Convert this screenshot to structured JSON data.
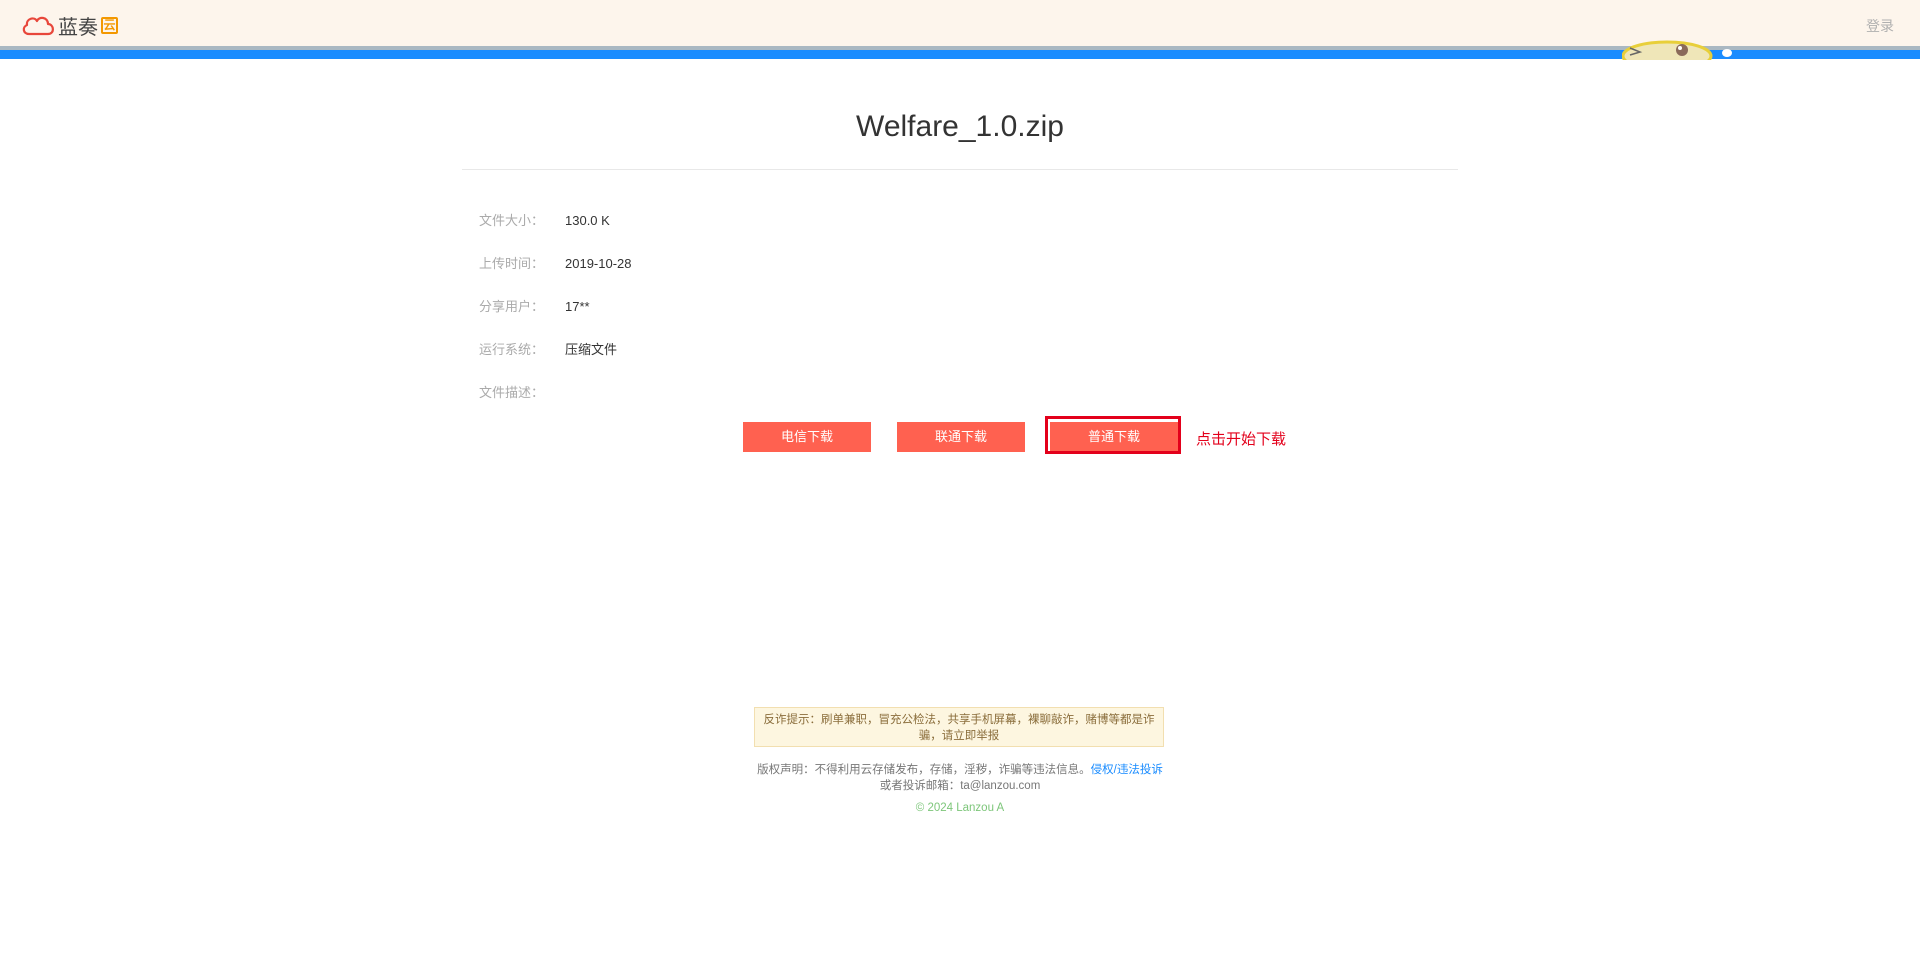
{
  "header": {
    "logo_text": "蓝奏",
    "logo_badge": "云",
    "login_label": "登录"
  },
  "file": {
    "title": "Welfare_1.0.zip",
    "info": [
      {
        "label": "文件大小：",
        "value": "130.0 K"
      },
      {
        "label": "上传时间：",
        "value": "2019-10-28"
      },
      {
        "label": "分享用户：",
        "value": "17**"
      },
      {
        "label": "运行系统：",
        "value": "压缩文件"
      },
      {
        "label": "文件描述：",
        "value": ""
      }
    ]
  },
  "downloads": {
    "telecom_label": "电信下载",
    "unicom_label": "联通下载",
    "normal_label": "普通下载",
    "annotation": "点击开始下载"
  },
  "footer": {
    "warning_text": "反诈提示：刷单兼职，冒充公检法，共享手机屏幕，裸聊敲诈，赌博等都是诈骗，请立即举报",
    "copyright_text": "版权声明：不得利用云存储发布，存储，淫秽，诈骗等违法信息。",
    "report_link": "侵权/违法投诉",
    "email_text": "或者投诉邮箱：ta@lanzou.com",
    "copy_text": "© 2024 Lanzou A"
  },
  "colors": {
    "accent_blue": "#1a8cff",
    "button_red": "#ff6150",
    "highlight_red": "#e3001b"
  }
}
